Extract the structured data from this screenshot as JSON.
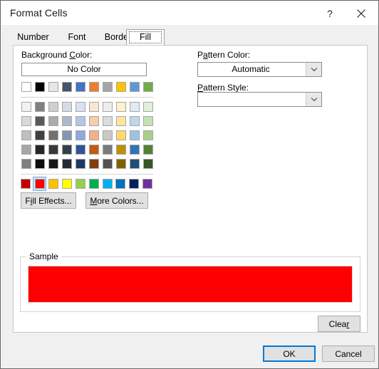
{
  "window": {
    "title": "Format Cells",
    "help_icon": "question-mark-icon",
    "close_icon": "close-icon"
  },
  "tabs": [
    {
      "label": "Number",
      "selected": false
    },
    {
      "label": "Font",
      "selected": false
    },
    {
      "label": "Border",
      "selected": false
    },
    {
      "label": "Fill",
      "selected": true
    }
  ],
  "fill_tab": {
    "background_color": {
      "label_pre": "Background ",
      "label_accel": "C",
      "label_post": "olor:",
      "no_color_label": "No Color"
    },
    "pattern_color": {
      "label_pre": "P",
      "label_accel": "a",
      "label_post": "ttern Color:",
      "value": "Automatic"
    },
    "pattern_style": {
      "label_pre": "",
      "label_accel": "P",
      "label_post": "attern Style:",
      "value": ""
    },
    "fill_effects_button": {
      "pre": "F",
      "accel": "i",
      "post": "ll Effects..."
    },
    "more_colors_button": {
      "pre": "",
      "accel": "M",
      "post": "ore Colors..."
    },
    "sample": {
      "legend": "Sample",
      "fill_color": "#FF0000"
    },
    "clear_button": {
      "pre": "Clea",
      "accel": "r",
      "post": ""
    },
    "selected_swatch": {
      "group": "standard",
      "index": 1,
      "color": "#FF0000"
    },
    "palette": {
      "theme_rows": [
        [
          "#FFFFFF",
          "#000000",
          "#E7E6E6",
          "#44546A",
          "#4472C4",
          "#ED7D31",
          "#A5A5A5",
          "#FFC000",
          "#5B9BD5",
          "#70AD47"
        ],
        [
          "#F2F2F2",
          "#808080",
          "#D0CECE",
          "#D6DCE4",
          "#D9E2F3",
          "#FBE5D5",
          "#EDEDED",
          "#FFF2CC",
          "#DEEBF6",
          "#E2EFD9"
        ],
        [
          "#D9D9D9",
          "#595959",
          "#AEAAAA",
          "#ACB9CA",
          "#B4C6E7",
          "#F7CBAC",
          "#DBDBDB",
          "#FFE599",
          "#BDD7EE",
          "#C5E0B3"
        ],
        [
          "#BFBFBF",
          "#404040",
          "#757070",
          "#8496B0",
          "#8FAADC",
          "#F4B183",
          "#C9C9C9",
          "#FFD966",
          "#9CC3E5",
          "#A8D08D"
        ],
        [
          "#A6A6A6",
          "#262626",
          "#3A3838",
          "#333F4F",
          "#2F5496",
          "#C55A11",
          "#7B7B7B",
          "#BF8F00",
          "#2E75B5",
          "#538135"
        ],
        [
          "#808080",
          "#0D0D0D",
          "#171616",
          "#222A35",
          "#1F3863",
          "#833C0B",
          "#525252",
          "#7F6000",
          "#1E4E79",
          "#375623"
        ]
      ],
      "standard_row": [
        "#C00000",
        "#FF0000",
        "#FFC000",
        "#FFFF00",
        "#92D050",
        "#00B050",
        "#00B0F0",
        "#0070C0",
        "#002060",
        "#7030A0"
      ]
    }
  },
  "footer": {
    "ok_label": "OK",
    "cancel_label": "Cancel"
  }
}
